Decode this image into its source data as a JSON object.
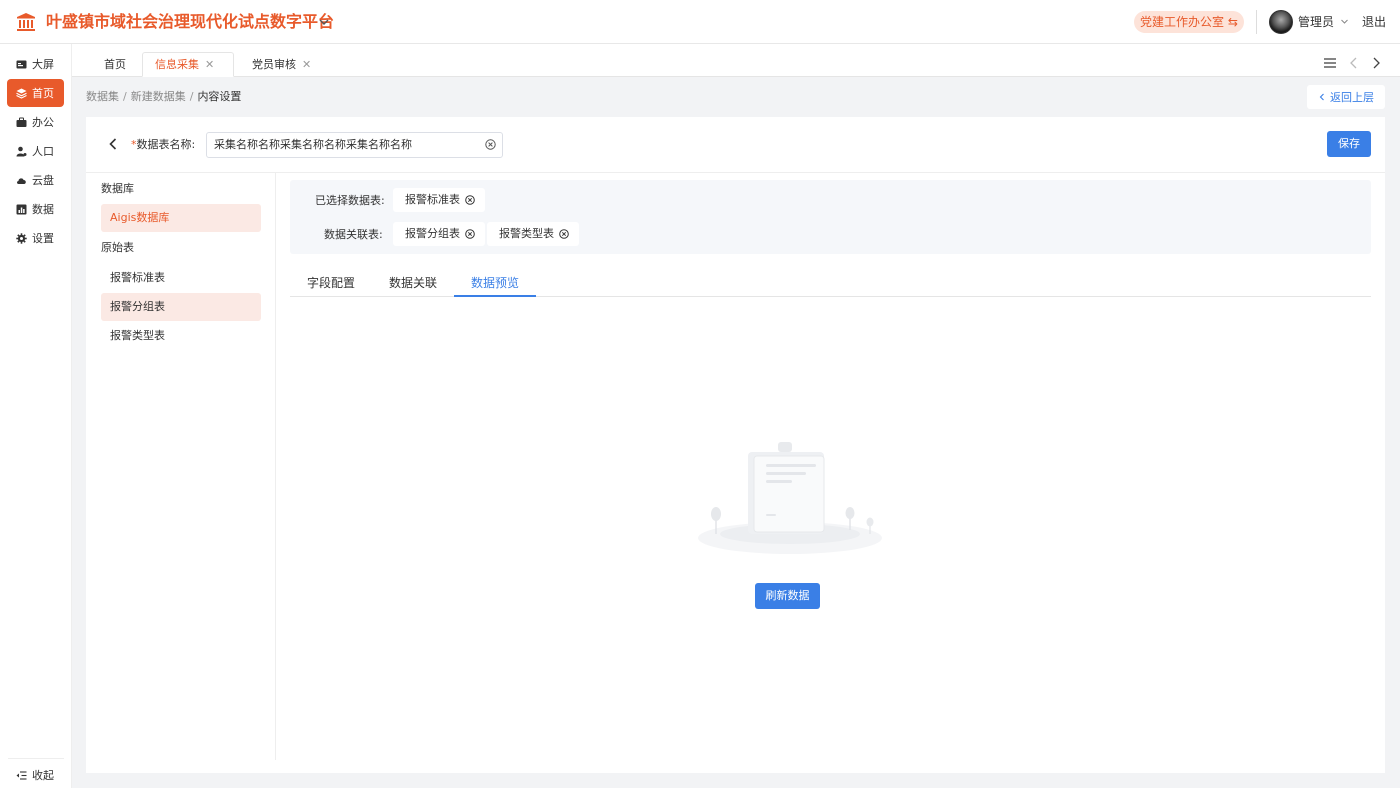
{
  "header": {
    "title": "叶盛镇市域社会治理现代化试点数字平台",
    "party_office": "党建工作办公室",
    "user_name": "管理员",
    "logout": "退出"
  },
  "sidebar": {
    "items": [
      {
        "label": "大屏",
        "icon": "screen-icon",
        "active": false
      },
      {
        "label": "首页",
        "icon": "layers-icon",
        "active": true
      },
      {
        "label": "办公",
        "icon": "briefcase-icon",
        "active": false
      },
      {
        "label": "人口",
        "icon": "person-icon",
        "active": false
      },
      {
        "label": "云盘",
        "icon": "cloud-icon",
        "active": false
      },
      {
        "label": "数据",
        "icon": "chart-icon",
        "active": false
      },
      {
        "label": "设置",
        "icon": "gear-icon",
        "active": false
      }
    ],
    "collapse_label": "收起"
  },
  "tabs": [
    {
      "label": "首页",
      "closable": false,
      "active": false
    },
    {
      "label": "信息采集",
      "closable": true,
      "active": true
    },
    {
      "label": "党员审核",
      "closable": true,
      "active": false
    }
  ],
  "breadcrumb": {
    "items": [
      "数据集",
      "新建数据集",
      "内容设置"
    ]
  },
  "back_button": "返回上层",
  "form": {
    "label": "数据表名称:",
    "value": "采集名称名称采集名称名称采集名称名称",
    "save_label": "保存"
  },
  "left_panel": {
    "db_title": "数据库",
    "db_item": "Aigis数据库",
    "raw_title": "原始表",
    "tables": [
      "报警标准表",
      "报警分组表",
      "报警类型表"
    ]
  },
  "selection": {
    "selected_label": "已选择数据表:",
    "selected_tables": [
      "报警标准表"
    ],
    "relation_label": "数据关联表:",
    "relation_tables": [
      "报警分组表",
      "报警类型表"
    ]
  },
  "subtabs": [
    {
      "label": "字段配置",
      "active": false
    },
    {
      "label": "数据关联",
      "active": false
    },
    {
      "label": "数据预览",
      "active": true
    }
  ],
  "refresh_label": "刷新数据",
  "colors": {
    "accent": "#e85a2b",
    "primary": "#3a7fe6"
  }
}
